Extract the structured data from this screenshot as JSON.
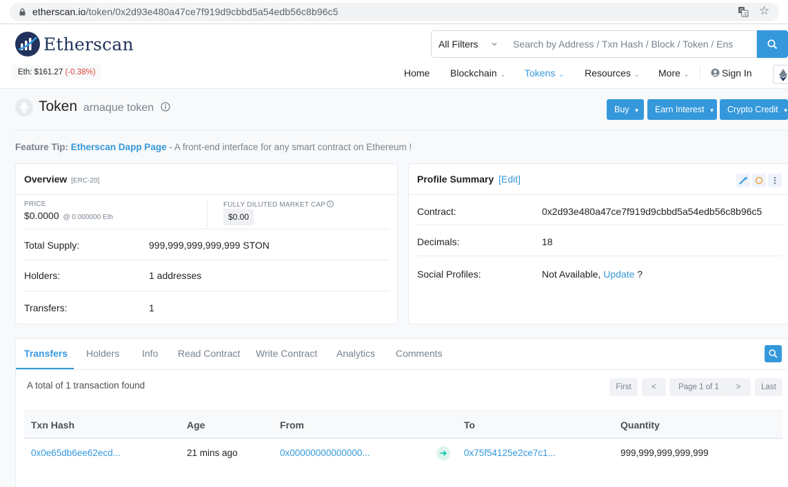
{
  "browser": {
    "url_host": "etherscan.io",
    "url_path": "/token/0x2d93e480a47ce7f919d9cbbd5a54edb56c8b96c5"
  },
  "header": {
    "logo_text": "Etherscan",
    "eth_price_label": "Eth: $161.27",
    "eth_price_change": "(-0.38%)",
    "filter_value": "All Filters",
    "search_placeholder": "Search by Address / Txn Hash / Block / Token / Ens",
    "nav": {
      "home": "Home",
      "blockchain": "Blockchain",
      "tokens": "Tokens",
      "resources": "Resources",
      "more": "More",
      "sign_in": "Sign In"
    }
  },
  "token": {
    "label": "Token",
    "name": "arnaque token",
    "buttons": {
      "buy": "Buy",
      "earn": "Earn Interest",
      "credit": "Crypto Credit"
    }
  },
  "feature_tip": {
    "prefix": "Feature Tip:",
    "link": "Etherscan Dapp Page",
    "text": " - A front-end interface for any smart contract on Ethereum !"
  },
  "overview": {
    "title": "Overview",
    "standard": "[ERC-20]",
    "price_label": "PRICE",
    "price_value": "$0.0000",
    "price_eth": "@ 0.000000 Eth",
    "mcap_label": "FULLY DILUTED MARKET CAP",
    "mcap_value": "$0.00",
    "supply_label": "Total Supply:",
    "supply_value": "999,999,999,999,999 STON",
    "holders_label": "Holders:",
    "holders_value": "1 addresses",
    "transfers_label": "Transfers:",
    "transfers_value": "1"
  },
  "profile": {
    "title": "Profile Summary",
    "edit": "[Edit]",
    "contract_label": "Contract:",
    "contract_value": "0x2d93e480a47ce7f919d9cbbd5a54edb56c8b96c5",
    "decimals_label": "Decimals:",
    "decimals_value": "18",
    "social_label": "Social Profiles:",
    "social_value": "Not Available,",
    "social_update": "Update",
    "social_q": "?"
  },
  "tabs": [
    "Transfers",
    "Holders",
    "Info",
    "Read Contract",
    "Write Contract",
    "Analytics",
    "Comments"
  ],
  "transfers": {
    "total_text": "A total of 1 transaction found",
    "pagination": {
      "first": "First",
      "prev": "<",
      "page": "Page 1 of 1",
      "next": ">",
      "last": "Last"
    },
    "columns": [
      "Txn Hash",
      "Age",
      "From",
      "To",
      "Quantity"
    ],
    "rows": [
      {
        "hash": "0x0e65db6ee62ecd...",
        "age": "21 mins ago",
        "from": "0x00000000000000...",
        "to": "0x75f54125e2ce7c1...",
        "quantity": "999,999,999,999,999"
      }
    ]
  },
  "colors": {
    "accent": "#3498db",
    "negative": "#de4437",
    "heading": "#21325b"
  }
}
